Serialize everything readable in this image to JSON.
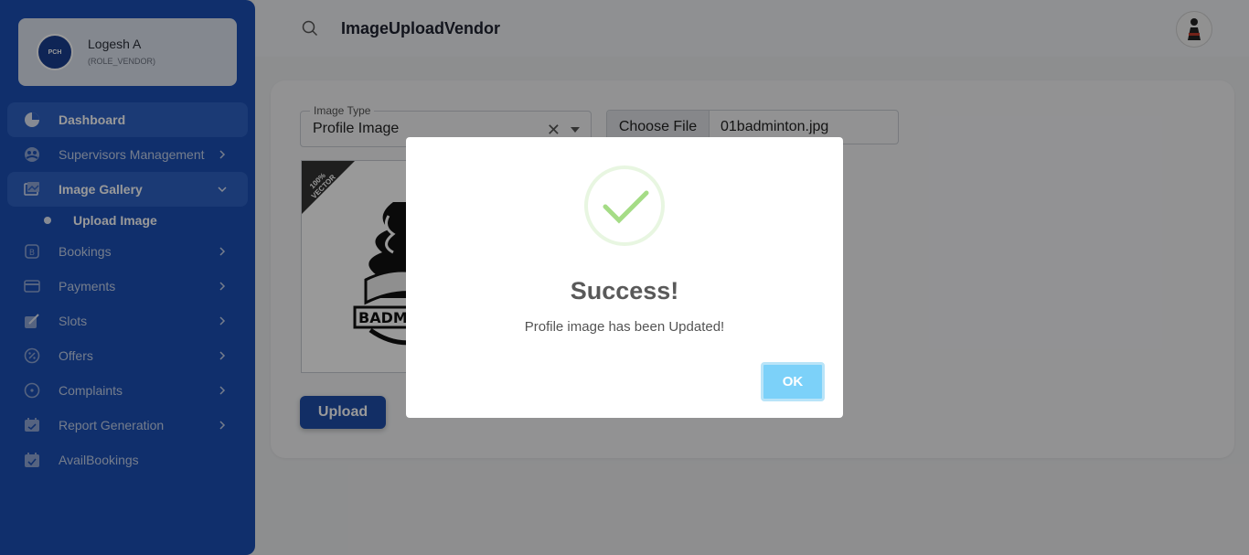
{
  "profile": {
    "name": "Logesh A",
    "role": "(ROLE_VENDOR)",
    "avatar_text": "PCH"
  },
  "sidebar": {
    "items": [
      {
        "label": "Dashboard",
        "icon": "pie-chart-icon",
        "active": true,
        "has_chevron": false
      },
      {
        "label": "Supervisors Management",
        "icon": "users-circle-icon",
        "has_chevron": true
      },
      {
        "label": "Image Gallery",
        "icon": "gallery-icon",
        "active": true,
        "expanded": true,
        "has_chevron": true
      },
      {
        "label": "Upload Image",
        "sub": true
      },
      {
        "label": "Bookings",
        "icon": "bookings-icon",
        "has_chevron": true
      },
      {
        "label": "Payments",
        "icon": "card-icon",
        "has_chevron": true
      },
      {
        "label": "Slots",
        "icon": "slots-icon",
        "has_chevron": true
      },
      {
        "label": "Offers",
        "icon": "offer-icon",
        "has_chevron": true
      },
      {
        "label": "Complaints",
        "icon": "complaint-icon",
        "has_chevron": true
      },
      {
        "label": "Report Generation",
        "icon": "report-icon",
        "has_chevron": true
      },
      {
        "label": "AvailBookings",
        "icon": "calendar-check-icon",
        "has_chevron": false
      }
    ]
  },
  "header": {
    "title": "ImageUploadVendor"
  },
  "form": {
    "image_type_label": "Image Type",
    "image_type_value": "Profile Image",
    "choose_file_label": "Choose File",
    "file_name": "01badminton.jpg",
    "upload_label": "Upload",
    "preview_ribbon_line1": "100%",
    "preview_ribbon_line2": "VECTOR",
    "preview_logo_text": "BADM"
  },
  "modal": {
    "title": "Success!",
    "message": "Profile image has been Updated!",
    "ok_label": "OK"
  },
  "colors": {
    "sidebar": "#1b4fb4",
    "accent": "#1f4ea8",
    "success": "#a5dc86",
    "ok_button": "#7cd1f9"
  }
}
